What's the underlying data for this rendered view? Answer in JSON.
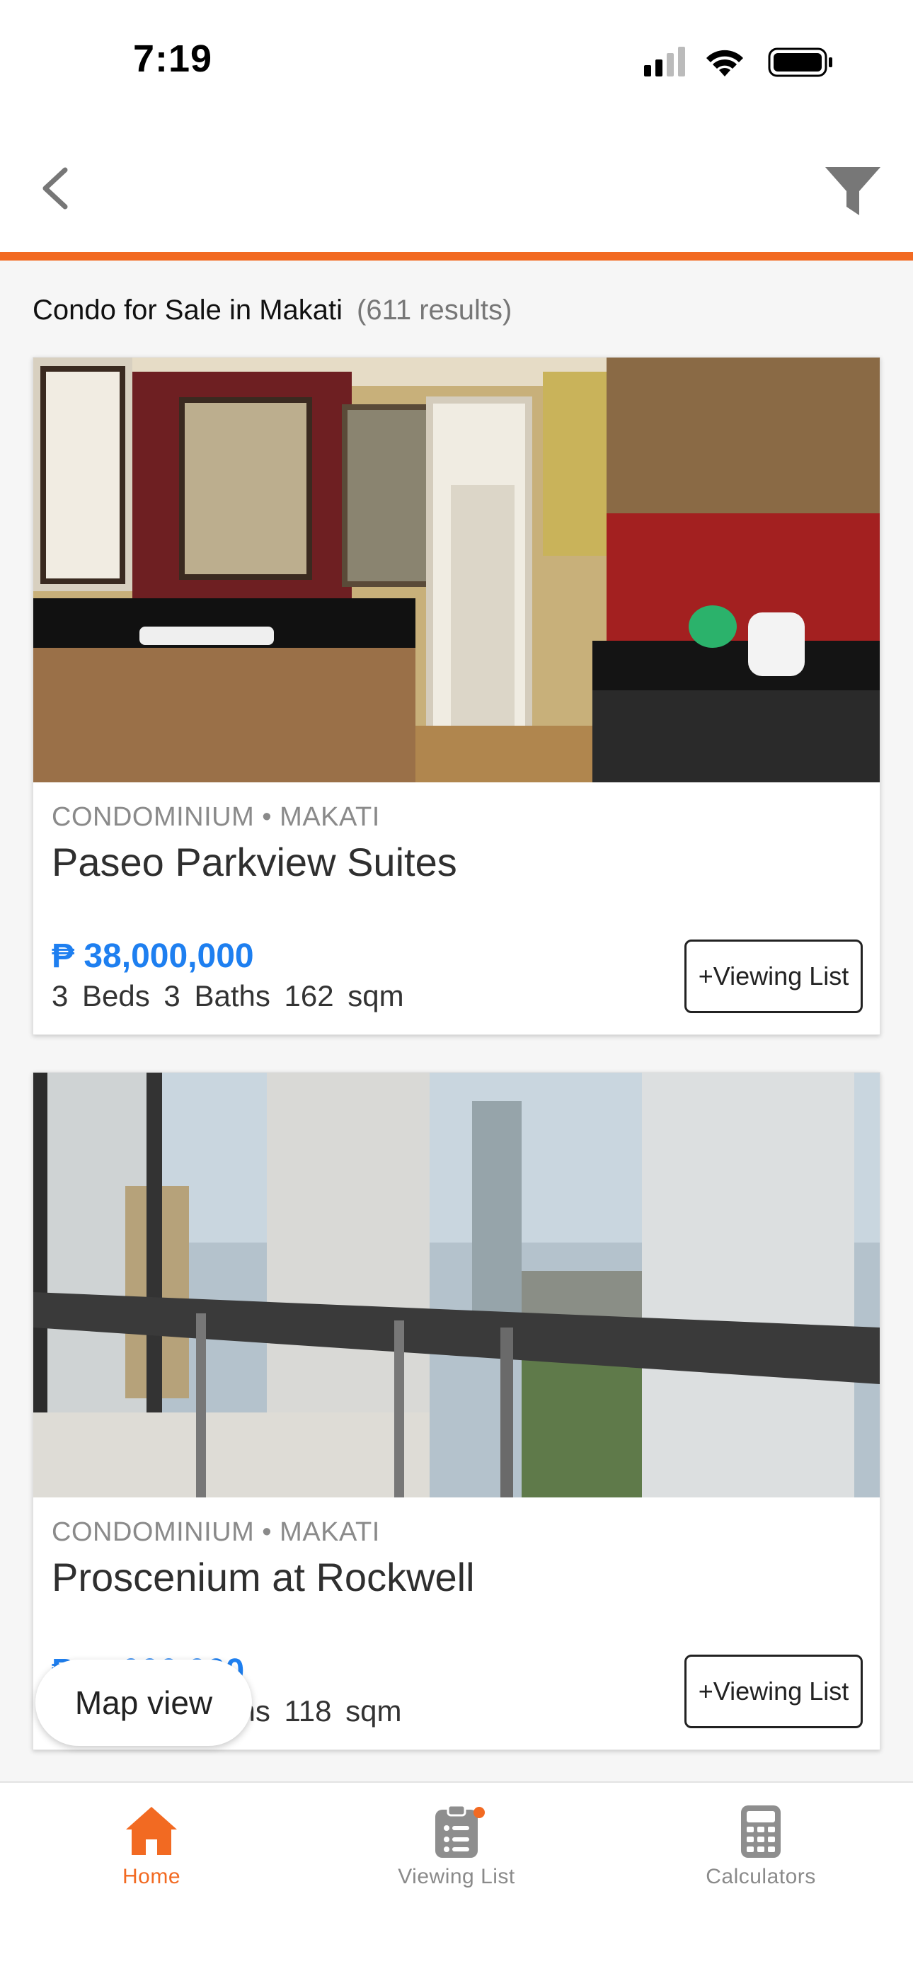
{
  "status_bar": {
    "time": "7:19"
  },
  "nav": {
    "back_icon": "chevron-left-icon",
    "filter_icon": "filter-icon"
  },
  "colors": {
    "accent": "#f26a22",
    "price": "#1e7ff0"
  },
  "results": {
    "title": "Condo for Sale in Makati",
    "count": "(611 results)"
  },
  "listings": [
    {
      "meta": "CONDOMINIUM • MAKATI",
      "title": "Paseo Parkview Suites",
      "price": "₱ 38,000,000",
      "specs": "3 Beds  3 Baths  162 sqm",
      "button": "+Viewing List"
    },
    {
      "meta": "CONDOMINIUM • MAKATI",
      "title": "Proscenium at Rockwell",
      "price": "₱ ...,000,000",
      "specs": "2 Beds  2 Baths  118 sqm",
      "button": "+Viewing List"
    }
  ],
  "map_view": {
    "label": "Map view"
  },
  "tabs": [
    {
      "label": "Home",
      "icon": "home-icon",
      "active": true
    },
    {
      "label": "Viewing List",
      "icon": "clipboard-icon",
      "badge": true
    },
    {
      "label": "Calculators",
      "icon": "calculator-icon"
    }
  ]
}
